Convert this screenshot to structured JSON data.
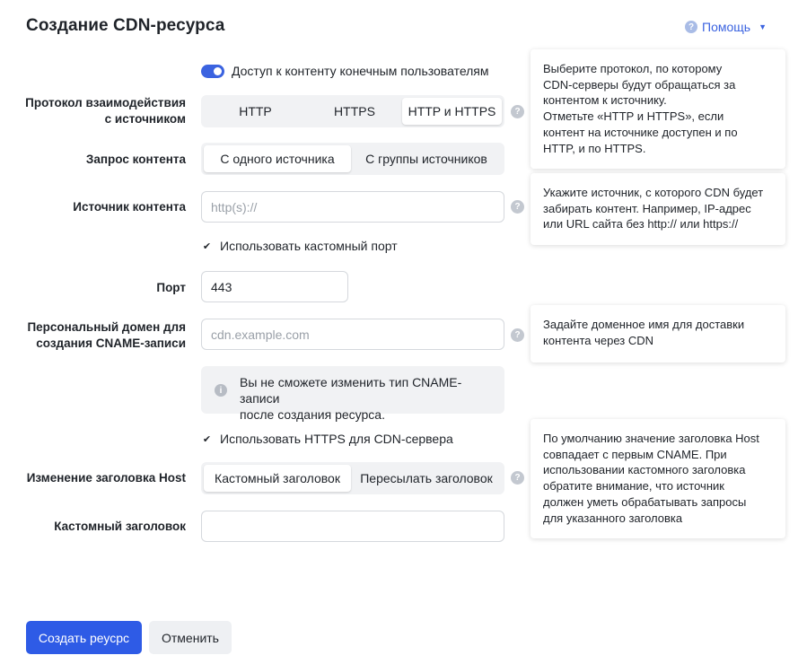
{
  "header": {
    "title": "Создание CDN-ресурса",
    "help_label": "Помощь"
  },
  "access_toggle": {
    "label": "Доступ к контенту конечным пользователям",
    "enabled": true
  },
  "protocol": {
    "label_line1": "Протокол взаимодействия",
    "label_line2": "с источником",
    "options": [
      "HTTP",
      "HTTPS",
      "HTTP и HTTPS"
    ],
    "selected": "HTTP и HTTPS"
  },
  "content_request": {
    "label": "Запрос контента",
    "options": [
      "С одного источника",
      "С группы источников"
    ],
    "selected": "С одного источника"
  },
  "content_source": {
    "label": "Источник контента",
    "placeholder": "http(s)://",
    "value": ""
  },
  "custom_port_checkbox": {
    "label": "Использовать кастомный порт",
    "checked": true
  },
  "port": {
    "label": "Порт",
    "value": "443"
  },
  "personal_domain": {
    "label_line1": "Персональный домен для",
    "label_line2": "создания CNAME-записи",
    "placeholder": "cdn.example.com",
    "value": ""
  },
  "cname_note": {
    "line1": "Вы не сможете изменить тип CNAME-записи",
    "line2": "после создания ресурса."
  },
  "https_checkbox": {
    "label": "Использовать HTTPS для CDN-сервера",
    "checked": true
  },
  "host_header": {
    "label": "Изменение заголовка Host",
    "options": [
      "Кастомный заголовок",
      "Пересылать заголовок"
    ],
    "selected": "Кастомный заголовок"
  },
  "custom_header": {
    "label": "Кастомный заголовок",
    "value": ""
  },
  "tips": {
    "protocol": [
      "Выберите протокол, по которому",
      "CDN-серверы будут обращаться за",
      "контентом к источнику.",
      "Отметьте «HTTP и HTTPS», если",
      "контент на источнике доступен и по",
      "HTTP, и по HTTPS."
    ],
    "source": [
      "Укажите источник, с которого CDN будет",
      "забирать контент. Например, IP-адрес",
      "или URL сайта без http:// или https://"
    ],
    "domain": [
      "Задайте доменное имя для доставки",
      "контента через CDN"
    ],
    "host": [
      "По умолчанию значение заголовка Host",
      "совпадает с первым CNAME. При",
      "использовании кастомного заголовка",
      "обратите внимание, что источник",
      "должен уметь обрабатывать запросы",
      "для указанного заголовка"
    ]
  },
  "actions": {
    "create": "Создать реусрс",
    "cancel": "Отменить"
  },
  "colors": {
    "accent": "#2e5be6",
    "toggle_on": "#3b63e0",
    "segment_bg": "#f1f2f4"
  }
}
